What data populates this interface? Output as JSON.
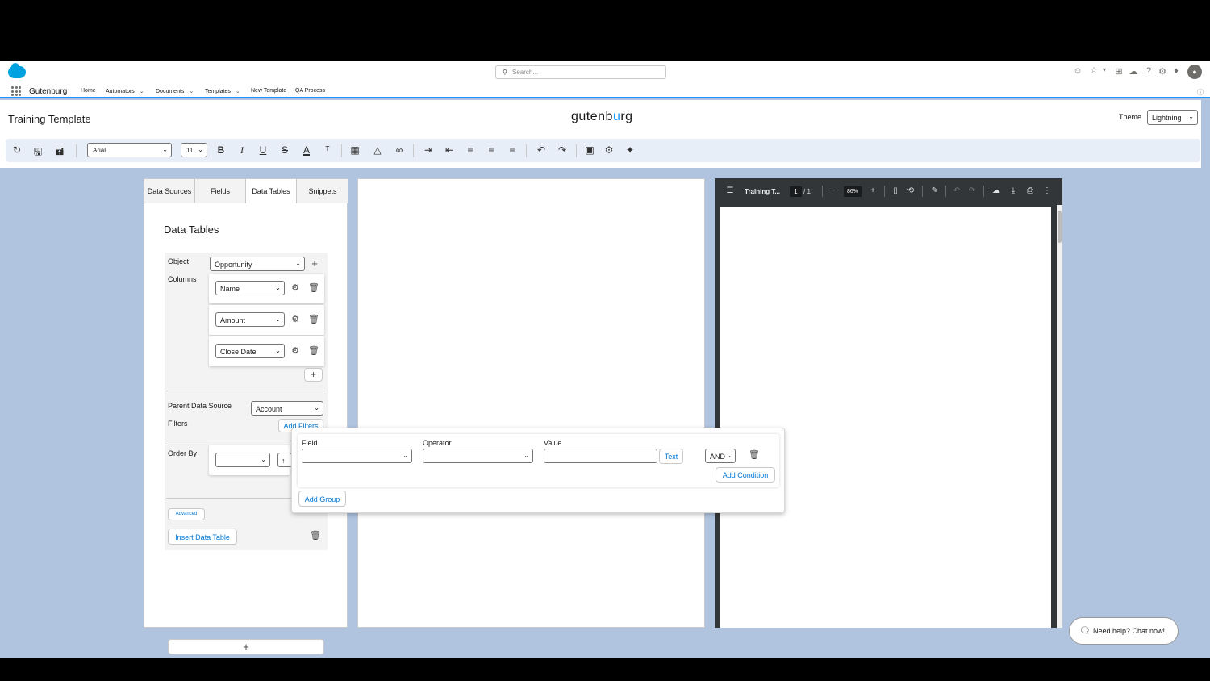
{
  "header": {
    "search_placeholder": "Search...",
    "app_name": "Gutenburg",
    "nav": [
      "Home",
      "Automators",
      "Documents",
      "Templates",
      "New Template",
      "QA Process"
    ]
  },
  "template": {
    "name": "Training Template",
    "logo_left": "gutenb",
    "logo_mid": "u",
    "logo_right": "rg",
    "theme_label": "Theme",
    "theme_value": "Lightning"
  },
  "toolbar": {
    "font": "Arial",
    "size": "11"
  },
  "left_panel": {
    "tabs": [
      "Data Sources",
      "Fields",
      "Data Tables",
      "Snippets"
    ],
    "active_tab": "Data Tables",
    "title": "Data Tables",
    "object_label": "Object",
    "object_value": "Opportunity",
    "columns_label": "Columns",
    "columns": [
      "Name",
      "Amount",
      "Close Date"
    ],
    "parent_label": "Parent Data Source",
    "parent_value": "Account",
    "filters_label": "Filters",
    "add_filters": "Add Filters",
    "order_label": "Order By",
    "advanced": "Advanced",
    "insert": "Insert Data Table",
    "add_plus": "+"
  },
  "pdf": {
    "title": "Training T...",
    "page": "1",
    "total": "/  1",
    "zoom": "86%"
  },
  "filter_popup": {
    "field_label": "Field",
    "operator_label": "Operator",
    "value_label": "Value",
    "text_btn": "Text",
    "logic": "AND",
    "add_condition": "Add Condition",
    "add_group": "Add Group"
  },
  "chat": "Need help? Chat now!",
  "colors": {
    "accent": "#0176d3",
    "bg": "#b0c4df",
    "brand": "#00a1e0"
  }
}
